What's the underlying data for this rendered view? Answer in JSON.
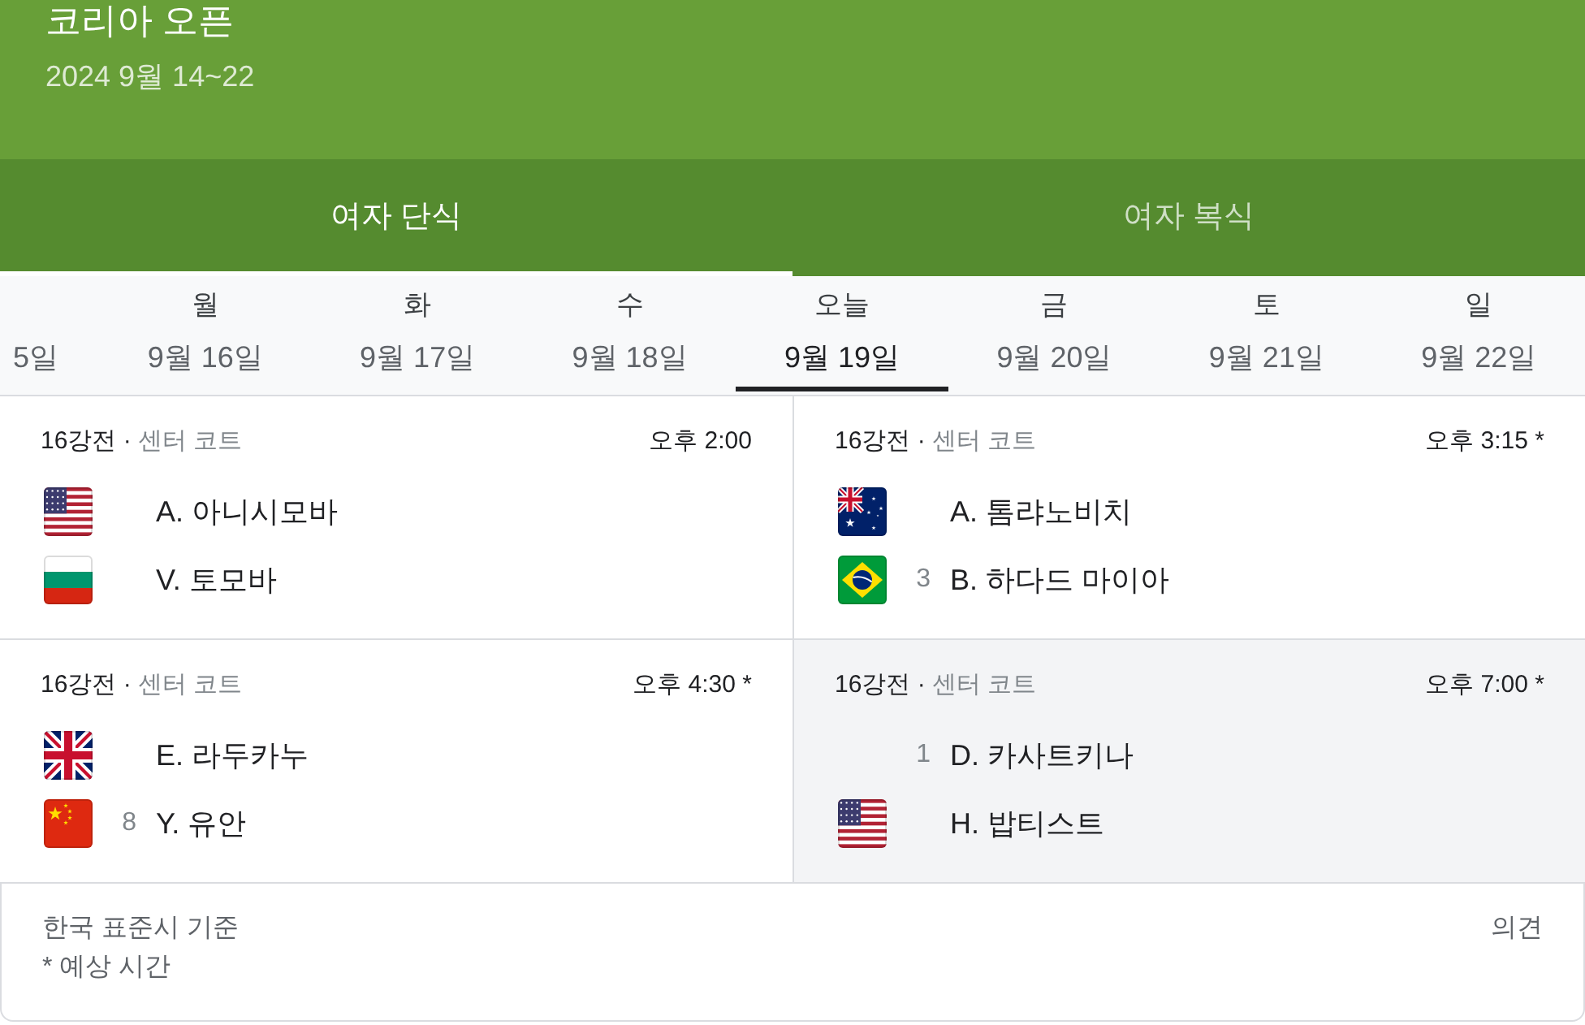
{
  "header": {
    "title": "코리아 오픈",
    "dates": "2024 9월 14~22"
  },
  "tabs": [
    {
      "label": "여자 단식",
      "selected": true
    },
    {
      "label": "여자 복식",
      "selected": false
    }
  ],
  "days": [
    {
      "date": "5일",
      "selected": false
    },
    {
      "weekday": "월",
      "date": "9월 16일",
      "selected": false
    },
    {
      "weekday": "화",
      "date": "9월 17일",
      "selected": false
    },
    {
      "weekday": "수",
      "date": "9월 18일",
      "selected": false
    },
    {
      "weekday": "오늘",
      "date": "9월 19일",
      "selected": true
    },
    {
      "weekday": "금",
      "date": "9월 20일",
      "selected": false
    },
    {
      "weekday": "토",
      "date": "9월 21일",
      "selected": false
    },
    {
      "weekday": "일",
      "date": "9월 22일",
      "selected": false
    }
  ],
  "matches": [
    {
      "round": "16강전 ·",
      "court": "센터 코트",
      "time": "오후 2:00",
      "highlighted": false,
      "players": [
        {
          "kind": "usa",
          "name": "A. 아니시모바"
        },
        {
          "kind": "bulgaria",
          "name": "V. 토모바"
        }
      ]
    },
    {
      "round": "16강전 ·",
      "court": "센터 코트",
      "time": "오후 3:15 *",
      "highlighted": false,
      "players": [
        {
          "kind": "australia",
          "name": "A. 톰랴노비치"
        },
        {
          "kind": "brazil",
          "seed": "3",
          "name": "B. 하다드 마이아"
        }
      ]
    },
    {
      "round": "16강전 ·",
      "court": "센터 코트",
      "time": "오후 4:30 *",
      "highlighted": false,
      "players": [
        {
          "kind": "uk",
          "name": "E. 라두카누"
        },
        {
          "kind": "china",
          "seed": "8",
          "name": "Y. 유안"
        }
      ]
    },
    {
      "round": "16강전 ·",
      "court": "센터 코트",
      "time": "오후 7:00 *",
      "highlighted": true,
      "players": [
        {
          "kind": "none",
          "seed": "1",
          "name": "D. 카사트키나"
        },
        {
          "kind": "usa",
          "name": "H. 밥티스트"
        }
      ]
    }
  ],
  "footer": {
    "notes": [
      "한국 표준시 기준",
      "* 예상 시간"
    ],
    "feedback": "의견"
  }
}
